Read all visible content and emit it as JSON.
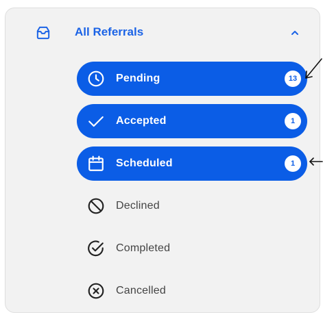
{
  "header": {
    "title": "All Referrals",
    "icon": "inbox-icon"
  },
  "items": [
    {
      "label": "Pending",
      "count": "13",
      "icon": "clock-icon"
    },
    {
      "label": "Accepted",
      "count": "1",
      "icon": "check-icon"
    },
    {
      "label": "Scheduled",
      "count": "1",
      "icon": "calendar-icon"
    },
    {
      "label": "Declined",
      "icon": "prohibited-icon"
    },
    {
      "label": "Completed",
      "icon": "check-circle-icon"
    },
    {
      "label": "Cancelled",
      "icon": "x-circle-icon"
    }
  ],
  "colors": {
    "accent": "#0b5de6",
    "panel_bg": "#f2f2f2",
    "text_muted": "#444444"
  }
}
